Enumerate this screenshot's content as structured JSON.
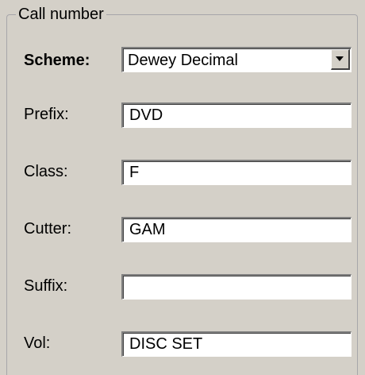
{
  "groupbox": {
    "title": "Call number"
  },
  "scheme": {
    "label": "Scheme:",
    "selected": "Dewey Decimal",
    "dropdown_icon": "chevron-down-icon"
  },
  "fields": {
    "prefix": {
      "label": "Prefix:",
      "value": "DVD"
    },
    "class": {
      "label": "Class:",
      "value": "F"
    },
    "cutter": {
      "label": "Cutter:",
      "value": "GAM"
    },
    "suffix": {
      "label": "Suffix:",
      "value": ""
    },
    "vol": {
      "label": "Vol:",
      "value": "DISC SET"
    }
  }
}
